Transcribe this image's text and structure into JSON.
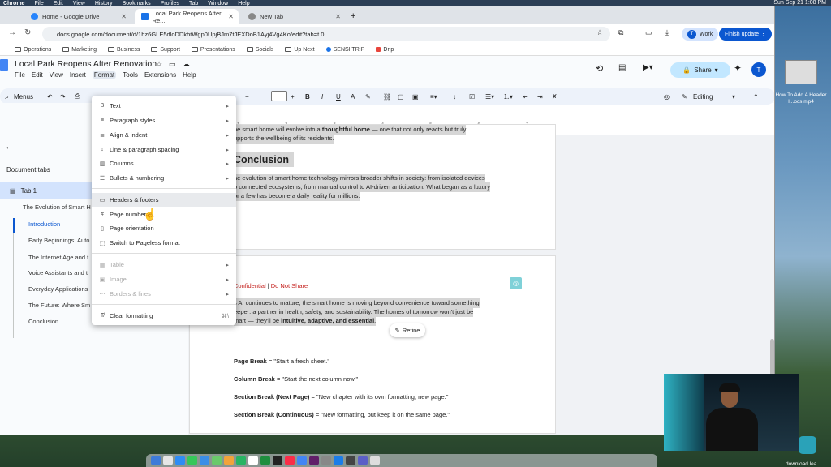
{
  "macos_menubar": {
    "app": "Chrome",
    "items": [
      "File",
      "Edit",
      "View",
      "History",
      "Bookmarks",
      "Profiles",
      "Tab",
      "Window",
      "Help"
    ],
    "clock": "Sun Sep 21 1:08 PM"
  },
  "browser": {
    "tabs": [
      {
        "title": "Home - Google Drive"
      },
      {
        "title": "Local Park Reopens After Re..."
      },
      {
        "title": "New Tab"
      }
    ],
    "url": "docs.google.com/document/d/1hz6GLE5dloDDkhtWgp0UpjBJm7tJEXDoB1Ayj4Vg4Ko/edit?tab=t.0",
    "profile_label": "Work",
    "profile_initial": "T",
    "finish_update": "Finish update",
    "bookmarks": [
      "Operations",
      "Marketing",
      "Business",
      "Support",
      "Presentations",
      "Socials",
      "Up Next",
      "SENSI TRIP",
      "Drip"
    ]
  },
  "doc": {
    "title": "Local Park Reopens After Renovation",
    "menu": [
      "File",
      "Edit",
      "View",
      "Insert",
      "Format",
      "Tools",
      "Extensions",
      "Help"
    ],
    "share_label": "Share",
    "user_initial": "T",
    "toolbar": {
      "search": "Menus",
      "mode": "Editing"
    }
  },
  "sidebar": {
    "header": "Document tabs",
    "tab_label": "Tab 1",
    "outline": [
      {
        "label": "The Evolution of Smart H",
        "active": false
      },
      {
        "label": "Introduction",
        "active": true
      },
      {
        "label": "Early Beginnings: Auto",
        "active": false
      },
      {
        "label": "The Internet Age and t",
        "active": false
      },
      {
        "label": "Voice Assistants and t",
        "active": false
      },
      {
        "label": "Everyday Applications",
        "active": false
      },
      {
        "label": "The Future: Where Sm",
        "active": false
      },
      {
        "label": "Conclusion",
        "active": false
      }
    ]
  },
  "format_menu": {
    "items": [
      {
        "icon": "B",
        "label": "Text",
        "submenu": true,
        "disabled": false
      },
      {
        "icon": "≡",
        "label": "Paragraph styles",
        "submenu": true,
        "disabled": false
      },
      {
        "icon": "≣",
        "label": "Align & indent",
        "submenu": true,
        "disabled": false
      },
      {
        "icon": "↕",
        "label": "Line & paragraph spacing",
        "submenu": true,
        "disabled": false
      },
      {
        "icon": "▥",
        "label": "Columns",
        "submenu": true,
        "disabled": false
      },
      {
        "icon": "☰",
        "label": "Bullets & numbering",
        "submenu": true,
        "disabled": false
      },
      {
        "icon": "▭",
        "label": "Headers & footers",
        "submenu": false,
        "disabled": false,
        "hover": true
      },
      {
        "icon": "#",
        "label": "Page numbers",
        "submenu": false,
        "disabled": false
      },
      {
        "icon": "▯",
        "label": "Page orientation",
        "submenu": false,
        "disabled": false
      },
      {
        "icon": "⬚",
        "label": "Switch to Pageless format",
        "submenu": false,
        "disabled": false
      },
      {
        "icon": "▦",
        "label": "Table",
        "submenu": true,
        "disabled": true
      },
      {
        "icon": "▣",
        "label": "Image",
        "submenu": true,
        "disabled": true
      },
      {
        "icon": "⋯",
        "label": "Borders & lines",
        "submenu": true,
        "disabled": true
      },
      {
        "icon": "T̸",
        "label": "Clear formatting",
        "shortcut": "⌘\\",
        "disabled": false
      }
    ]
  },
  "page1": {
    "line1_pre": "he smart home will evolve into a ",
    "line1_bold": "thoughtful home",
    "line1_post": " — one that not only reacts but truly",
    "line2": "upports the wellbeing of its residents.",
    "heading": "Conclusion",
    "para": [
      "he evolution of smart home technology mirrors broader shifts in society: from isolated devices",
      "o connected ecosystems, from manual control to AI-driven anticipation. What began as a luxury",
      "or a few has become a daily reality for millions."
    ]
  },
  "page2": {
    "header_conf": "Confidential",
    "header_sep": " | ",
    "header_share": "Do Not Share",
    "para": [
      "s AI continues to mature, the smart home is moving beyond convenience toward something",
      "eeper: a partner in health, safety, and sustainability. The homes of tomorrow won't just be"
    ],
    "para_last_pre": "mart — they'll be ",
    "para_last_bold": "intuitive, adaptive, and essential",
    "refine": "Refine",
    "breaks": [
      {
        "term": "Page Break",
        "def": " = \"Start a fresh sheet.\""
      },
      {
        "term": "Column Break",
        "def": " = \"Start the next column now.\""
      },
      {
        "term": "Section Break (Next Page)",
        "def": " = \"New chapter with its own formatting, new page.\""
      },
      {
        "term": "Section Break (Continuous)",
        "def": " = \"New formatting, but keep it on the same page.\""
      }
    ]
  },
  "desktop": {
    "file_label": "How To Add A Header I...ocs.mp4",
    "download": "download lea..."
  }
}
